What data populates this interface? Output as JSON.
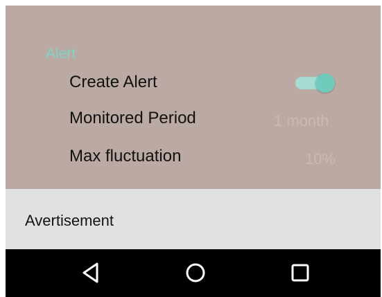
{
  "settings": {
    "section_title": "Alert",
    "rows": [
      {
        "label": "Create Alert",
        "toggle_on": true
      },
      {
        "label": "Monitored Period",
        "value": "1 month"
      },
      {
        "label": "Max fluctuation",
        "value": "10%"
      }
    ]
  },
  "ad": {
    "text": "Avertisement"
  },
  "navbar": {
    "buttons": [
      "back-icon",
      "home-icon",
      "recents-icon"
    ]
  },
  "colors": {
    "background": "#bba9a3",
    "accent": "#70cbbd",
    "ad_background": "#e1e1e1",
    "navbar": "#000000"
  }
}
